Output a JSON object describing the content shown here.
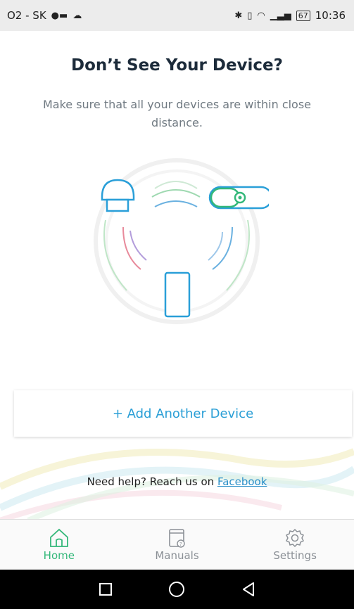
{
  "status_bar": {
    "left_text": "O2 - SK",
    "battery": "67",
    "time": "10:36"
  },
  "screen": {
    "title": "Don’t See Your Device?",
    "subtitle": "Make sure that all your devices are within close distance."
  },
  "add_device_label": "+ Add Another Device",
  "help": {
    "prefix": "Need help? Reach us on ",
    "link_text": "Facebook"
  },
  "tabs": [
    {
      "label": "Home",
      "icon": "home-icon",
      "active": true
    },
    {
      "label": "Manuals",
      "icon": "manual-icon",
      "active": false
    },
    {
      "label": "Settings",
      "icon": "gear-icon",
      "active": false
    }
  ],
  "colors": {
    "accent_green": "#34b87a",
    "link_blue": "#2b9fd6",
    "phone_blue": "#2a9fd8"
  }
}
